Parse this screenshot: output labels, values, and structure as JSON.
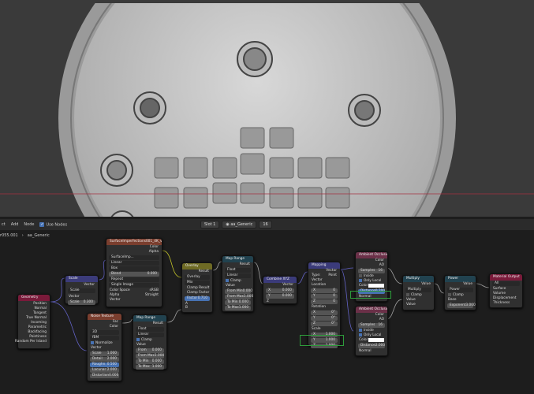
{
  "header": {
    "view": "ct",
    "add": "Add",
    "node": "Node",
    "use_nodes": "Use Nodes",
    "slot": "Slot 1",
    "material": "aa_Generic",
    "users": "16"
  },
  "breadcrumb": {
    "object": "r055.001",
    "material": "aa_Generic"
  },
  "nodes": {
    "geometry": {
      "title": "Geometry",
      "outputs": [
        "Position",
        "Normal",
        "Tangent",
        "True Normal",
        "Incoming",
        "Parametric",
        "Backfacing",
        "Pointiness",
        "Random Per Island"
      ]
    },
    "scale": {
      "title": "Scale",
      "vec": "Vector",
      "mode": "Scale",
      "vector": "Vector",
      "scale_label": "Scale",
      "scale_val": "0.300"
    },
    "image": {
      "title": "SurfaceImperfections001_4K_var1.jpg",
      "color": "Color",
      "alpha": "Alpha",
      "file": "SurfaceImp...",
      "interp": "Linear",
      "proj": "Box",
      "blend_label": "Blend",
      "blend_val": "0.000",
      "ext": "Repeat",
      "source": "Single Image",
      "cs_label": "Color Space",
      "cs_val": "sRGB",
      "alpha_label": "Alpha",
      "alpha_val": "Straight",
      "vector": "Vector"
    },
    "noise": {
      "title": "Noise Texture",
      "fac": "Fac",
      "color": "Color",
      "dim": "3D",
      "type": "fBM",
      "normalize": "Normalize",
      "vector": "Vector",
      "scale": [
        "Scale",
        "1.000"
      ],
      "detail": [
        "Detail",
        "2.000"
      ],
      "rough": [
        "Roughn.",
        "0.500"
      ],
      "lac": [
        "Lacunar.",
        "2.000"
      ],
      "dist": [
        "Distortion",
        "0.000"
      ]
    },
    "overlay": {
      "title": "Overlay",
      "result": "Result",
      "mode": "Overlay",
      "type": "Mix",
      "clamp_result": "Clamp Result",
      "clamp_factor": "Clamp Factor",
      "factor": [
        "Factor",
        "0.710"
      ],
      "a": "A",
      "b": "B"
    },
    "maprange1": {
      "title": "Map Range",
      "result": "Result",
      "type": "Float",
      "interp": "Linear",
      "clamp": "Clamp",
      "value": "Value",
      "fmin": [
        "From Min",
        "0.000"
      ],
      "fmax": [
        "From Max",
        "1.000"
      ],
      "tmin": [
        "To Min",
        "0.000"
      ],
      "tmax": [
        "To Max",
        "1.000"
      ]
    },
    "maprange2": {
      "title": "Map Range",
      "result": "Result",
      "type": "Float",
      "interp": "Linear",
      "clamp": "Clamp",
      "value": "Value",
      "fmin": [
        "From",
        "0.000"
      ],
      "fmax": [
        "From Max",
        "1.000"
      ],
      "tmin": [
        "To Min",
        "0.000"
      ],
      "tmax": [
        "To Max",
        "1.000"
      ]
    },
    "combine": {
      "title": "Combine XYZ",
      "vector": "Vector",
      "x": [
        "X",
        "0.000"
      ],
      "y": [
        "Y",
        "0.000"
      ],
      "z": "Z"
    },
    "mapping": {
      "title": "Mapping",
      "vector_out": "Vector",
      "type_label": "Type:",
      "type_val": "Point",
      "vector": "Vector",
      "location": "Location",
      "loc": [
        "0",
        "0",
        "0"
      ],
      "rotation": "Rotation",
      "rot": [
        "0°",
        "0°",
        "0°"
      ],
      "scale": "Scale",
      "sc": [
        "1.000",
        "1.000",
        "1.000"
      ]
    },
    "ao1": {
      "title": "Ambient Occlusion",
      "color": "Color",
      "ao": "AO",
      "samples": [
        "Samples",
        "16"
      ],
      "inside": "Inside",
      "only_local": "Only Local",
      "color_in": "Color",
      "distance": [
        "Distance",
        "0.200"
      ],
      "normal": "Normal"
    },
    "ao2": {
      "title": "Ambient Occlusion",
      "color": "Color",
      "ao": "AO",
      "samples": [
        "Samples",
        "16"
      ],
      "inside": "Inside",
      "only_local": "Only Local",
      "color_in": "Color",
      "distance": [
        "Distance",
        "2.000"
      ],
      "normal": "Normal"
    },
    "multiply": {
      "title": "Multiply",
      "value": "Value",
      "op": "Multiply",
      "clamp": "Clamp",
      "v1": "Value",
      "v2": "Value"
    },
    "power": {
      "title": "Power",
      "value": "Value",
      "op": "Power",
      "clamp": "Clamp",
      "base": "Base",
      "exp": [
        "Exponent",
        "3.000"
      ]
    },
    "output": {
      "title": "Material Output",
      "target": "All",
      "surface": "Surface",
      "volume": "Volume",
      "disp": "Displacement",
      "thick": "Thickness"
    }
  }
}
